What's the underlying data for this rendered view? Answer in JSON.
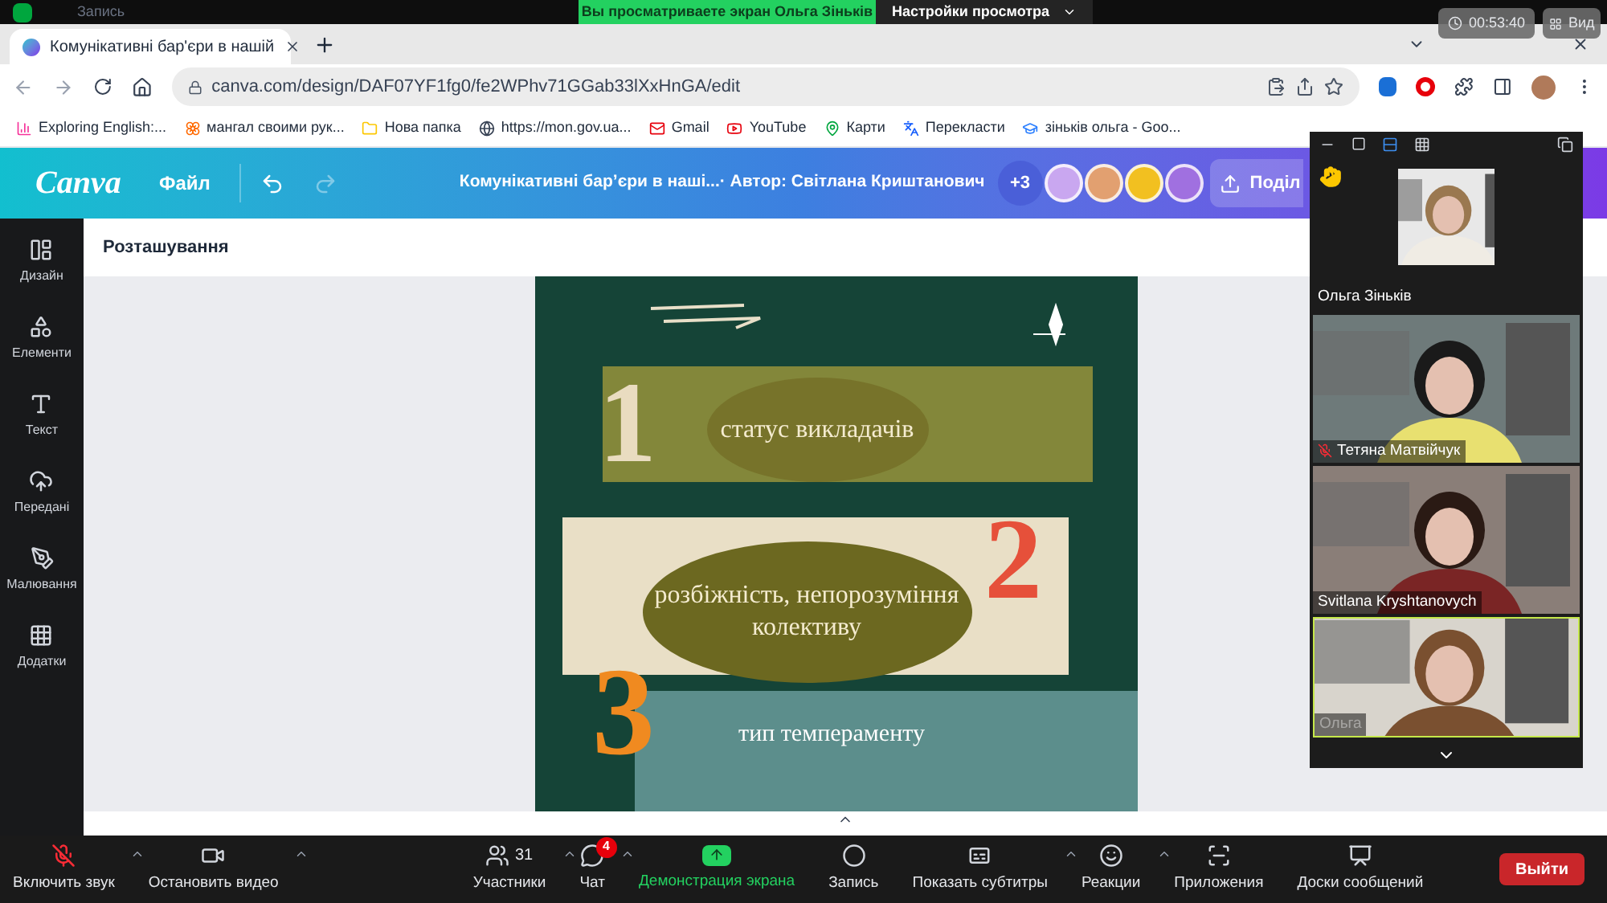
{
  "meeting_bar": {
    "recording_label": "Запись",
    "banner": "Вы просматриваете экран Ольга Зіньків",
    "view_settings": "Настройки просмотра",
    "timer": "00:53:40",
    "view_button": "Вид"
  },
  "browser": {
    "tabs": [
      {
        "label": "Комунікативні бар'єри в нашій",
        "selected": true
      }
    ],
    "url": "canva.com/design/DAF07YF1fg0/fe2WPhv71GGab33lXxHnGA/edit",
    "bookmarks": [
      {
        "label": "Exploring English:...",
        "kind": "chart"
      },
      {
        "label": "мангал своими рук...",
        "kind": "flower"
      },
      {
        "label": "Нова папка",
        "kind": "folder"
      },
      {
        "label": "https://mon.gov.ua...",
        "kind": "globe"
      },
      {
        "label": "Gmail",
        "kind": "mail"
      },
      {
        "label": "YouTube",
        "kind": "video"
      },
      {
        "label": "Карти",
        "kind": "pin"
      },
      {
        "label": "Перекласти",
        "kind": "translate"
      },
      {
        "label": "зіньків ольга - Goo...",
        "kind": "cap"
      }
    ]
  },
  "canva": {
    "logo": "Canva",
    "file_menu": "Файл",
    "title": "Комунікативні бар’єри в наші...· Автор: Світлана Криштанович",
    "collaborators_more": "+3",
    "share_button": "Поділ",
    "sidebar": [
      {
        "label": "Дизайн",
        "kind": "layout"
      },
      {
        "label": "Елементи",
        "kind": "shapes"
      },
      {
        "label": "Текст",
        "kind": "text"
      },
      {
        "label": "Передані",
        "kind": "upload"
      },
      {
        "label": "Малювання",
        "kind": "draw"
      },
      {
        "label": "Додатки",
        "kind": "apps"
      }
    ],
    "panel_title": "Розташування",
    "design": {
      "items": [
        {
          "number": "1",
          "text": "статус викладачів"
        },
        {
          "number": "2",
          "text": "розбіжність, непорозуміння колективу"
        },
        {
          "number": "3",
          "text": "тип темпераменту"
        }
      ]
    }
  },
  "participants_panel": {
    "tiles": [
      {
        "name": "Ольга Зіньків",
        "kind": "small"
      },
      {
        "name": "Тетяна Матвійчук",
        "kind": "video",
        "muted": true
      },
      {
        "name": "Svitlana Kryshtanovych",
        "kind": "video",
        "muted": false
      },
      {
        "name": "Ольга",
        "kind": "video",
        "muted": false
      }
    ]
  },
  "toolbar": {
    "items": [
      {
        "label": "Включить звук",
        "kind": "mic-off",
        "menu": true
      },
      {
        "label": "Остановить видео",
        "kind": "video",
        "menu": true
      },
      {
        "label": "Участники",
        "kind": "participants",
        "count": "31",
        "menu": true
      },
      {
        "label": "Чат",
        "kind": "chat",
        "badge": "4",
        "menu": true
      },
      {
        "label": "Демонстрация экрана",
        "kind": "share",
        "menu": false
      },
      {
        "label": "Запись",
        "kind": "record",
        "menu": false
      },
      {
        "label": "Показать субтитры",
        "kind": "captions",
        "menu": true
      },
      {
        "label": "Реакции",
        "kind": "reactions",
        "menu": true
      },
      {
        "label": "Приложения",
        "kind": "apps",
        "menu": false
      },
      {
        "label": "Доски сообщений",
        "kind": "whiteboard",
        "menu": false
      }
    ],
    "leave": "Выйти"
  }
}
